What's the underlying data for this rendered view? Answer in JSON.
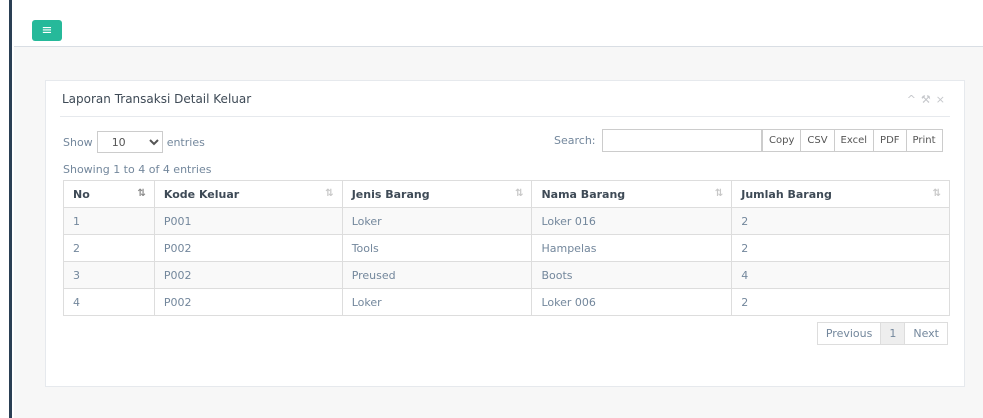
{
  "header": {
    "menu_icon": "hamburger-icon",
    "menu_glyph": "≡"
  },
  "panel": {
    "title": "Laporan Transaksi Detail Keluar",
    "tools": {
      "collapse": "^",
      "settings": "⚒",
      "close": "×"
    }
  },
  "length": {
    "show_label": "Show",
    "value": "10",
    "entries_label": "entries"
  },
  "search": {
    "label": "Search:",
    "value": ""
  },
  "export_buttons": [
    "Copy",
    "CSV",
    "Excel",
    "PDF",
    "Print"
  ],
  "info": "Showing 1 to 4 of 4 entries",
  "table": {
    "columns": [
      "No",
      "Kode Keluar",
      "Jenis Barang",
      "Nama Barang",
      "Jumlah Barang"
    ],
    "rows": [
      [
        "1",
        "P001",
        "Loker",
        "Loker 016",
        "2"
      ],
      [
        "2",
        "P002",
        "Tools",
        "Hampelas",
        "2"
      ],
      [
        "3",
        "P002",
        "Preused",
        "Boots",
        "4"
      ],
      [
        "4",
        "P002",
        "Loker",
        "Loker 006",
        "2"
      ]
    ]
  },
  "pagination": {
    "previous": "Previous",
    "current": "1",
    "next": "Next"
  },
  "colors": {
    "accent": "#26b99a",
    "sidebar": "#2a3f54"
  }
}
